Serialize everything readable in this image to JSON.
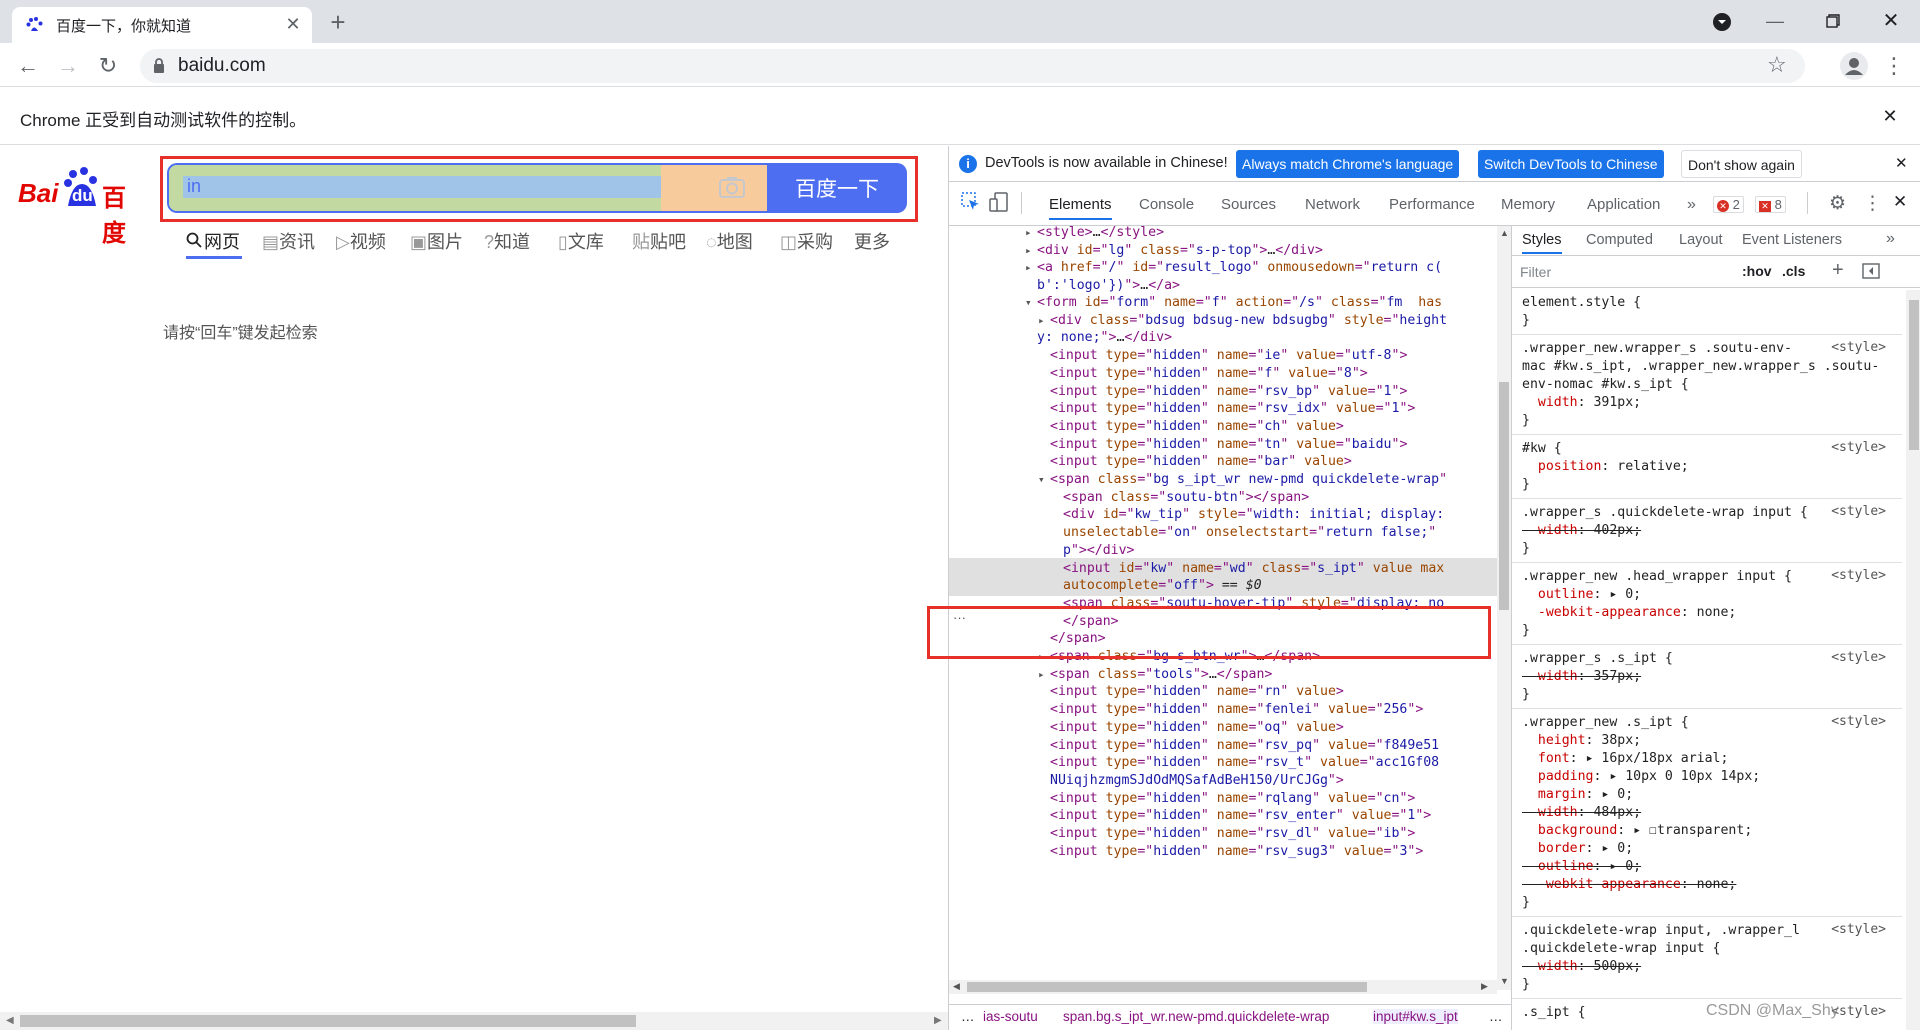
{
  "browser": {
    "tab_title": "百度一下，你就知道",
    "url": "baidu.com",
    "infobar_text": "Chrome 正受到自动测试软件的控制。"
  },
  "page": {
    "logo_text_bai": "Bai",
    "logo_text_du": "du",
    "logo_text_cn": "百度",
    "search_value": "in",
    "search_button": "百度一下",
    "nav": [
      {
        "icon": "search-icon",
        "label": "网页"
      },
      {
        "icon": "news-icon",
        "label": "资讯"
      },
      {
        "icon": "video-icon",
        "label": "视频"
      },
      {
        "icon": "image-icon",
        "label": "图片"
      },
      {
        "icon": "question-icon",
        "label": "知道"
      },
      {
        "icon": "doc-icon",
        "label": "文库"
      },
      {
        "icon": "tieba-icon",
        "label": "贴吧"
      },
      {
        "icon": "map-icon",
        "label": "地图"
      },
      {
        "icon": "bag-icon",
        "label": "采购"
      },
      {
        "icon": "",
        "label": "更多"
      }
    ],
    "hint": "请按“回车”键发起检索"
  },
  "devtools": {
    "notice": "DevTools is now available in Chinese!",
    "btn_match": "Always match Chrome's language",
    "btn_switch": "Switch DevTools to Chinese",
    "btn_dont": "Don't show again",
    "tabs": [
      "Elements",
      "Console",
      "Sources",
      "Network",
      "Performance",
      "Memory",
      "Application"
    ],
    "errors": "2",
    "warnings": "8",
    "elements": [
      {
        "indent": 0,
        "arrow": "▸",
        "html": "<span class='tag'>&lt;style&gt;</span><span class='tx'>…</span><span class='tag'>&lt;/style&gt;</span>"
      },
      {
        "indent": 0,
        "arrow": "▸",
        "html": "<span class='tag'>&lt;div </span><span class='an'>id</span>=\"<span class='av'>lg</span>\" <span class='an'>class</span>=\"<span class='av'>s-p-top</span>\"<span class='tag'>&gt;</span><span class='tx'>…</span><span class='tag'>&lt;/div&gt;</span>"
      },
      {
        "indent": 0,
        "arrow": "▸",
        "html": "<span class='tag'>&lt;a </span><span class='an'>href</span>=\"<span class='av'>/</span>\" <span class='an'>id</span>=\"<span class='av'>result_logo</span>\" <span class='an'>onmousedown</span>=\"<span class='av'>return c(</span>"
      },
      {
        "indent": 0,
        "arrow": "",
        "html": "<span class='av'>b':'logo'})</span>\"<span class='tag'>&gt;</span><span class='tx'>…</span><span class='tag'>&lt;/a&gt;</span>"
      },
      {
        "indent": 0,
        "arrow": "▾",
        "html": "<span class='tag'>&lt;form </span><span class='an'>id</span>=\"<span class='av'>form</span>\" <span class='an'>name</span>=\"<span class='av'>f</span>\" <span class='an'>action</span>=\"<span class='av'>/s</span>\" <span class='an'>class</span>=\"<span class='av'>fm</span>  <span class='an'>has</span>"
      },
      {
        "indent": 1,
        "arrow": "▸",
        "html": "<span class='tag'>&lt;div </span><span class='an'>class</span>=\"<span class='av'>bdsug bdsug-new bdsugbg</span>\" <span class='an'>style</span>=\"<span class='av'>height</span>"
      },
      {
        "indent": 0,
        "arrow": "",
        "html": "<span class='av'>y: none;</span>\"<span class='tag'>&gt;</span><span class='tx'>…</span><span class='tag'>&lt;/div&gt;</span>"
      },
      {
        "indent": 1,
        "arrow": "",
        "html": "<span class='tag'>&lt;input </span><span class='an'>type</span>=\"<span class='av'>hidden</span>\" <span class='an'>name</span>=\"<span class='av'>ie</span>\" <span class='an'>value</span>=\"<span class='av'>utf-8</span>\"<span class='tag'>&gt;</span>"
      },
      {
        "indent": 1,
        "arrow": "",
        "html": "<span class='tag'>&lt;input </span><span class='an'>type</span>=\"<span class='av'>hidden</span>\" <span class='an'>name</span>=\"<span class='av'>f</span>\" <span class='an'>value</span>=\"<span class='av'>8</span>\"<span class='tag'>&gt;</span>"
      },
      {
        "indent": 1,
        "arrow": "",
        "html": "<span class='tag'>&lt;input </span><span class='an'>type</span>=\"<span class='av'>hidden</span>\" <span class='an'>name</span>=\"<span class='av'>rsv_bp</span>\" <span class='an'>value</span>=\"<span class='av'>1</span>\"<span class='tag'>&gt;</span>"
      },
      {
        "indent": 1,
        "arrow": "",
        "html": "<span class='tag'>&lt;input </span><span class='an'>type</span>=\"<span class='av'>hidden</span>\" <span class='an'>name</span>=\"<span class='av'>rsv_idx</span>\" <span class='an'>value</span>=\"<span class='av'>1</span>\"<span class='tag'>&gt;</span>"
      },
      {
        "indent": 1,
        "arrow": "",
        "html": "<span class='tag'>&lt;input </span><span class='an'>type</span>=\"<span class='av'>hidden</span>\" <span class='an'>name</span>=\"<span class='av'>ch</span>\" <span class='an'>value</span><span class='tag'>&gt;</span>"
      },
      {
        "indent": 1,
        "arrow": "",
        "html": "<span class='tag'>&lt;input </span><span class='an'>type</span>=\"<span class='av'>hidden</span>\" <span class='an'>name</span>=\"<span class='av'>tn</span>\" <span class='an'>value</span>=\"<span class='av'>baidu</span>\"<span class='tag'>&gt;</span>"
      },
      {
        "indent": 1,
        "arrow": "",
        "html": "<span class='tag'>&lt;input </span><span class='an'>type</span>=\"<span class='av'>hidden</span>\" <span class='an'>name</span>=\"<span class='av'>bar</span>\" <span class='an'>value</span><span class='tag'>&gt;</span>"
      },
      {
        "indent": 1,
        "arrow": "▾",
        "html": "<span class='tag'>&lt;span </span><span class='an'>class</span>=\"<span class='av'>bg s_ipt_wr new-pmd quickdelete-wrap</span>\""
      },
      {
        "indent": 2,
        "arrow": "",
        "html": "<span class='tag'>&lt;span </span><span class='an'>class</span>=\"<span class='av'>soutu-btn</span>\"<span class='tag'>&gt;&lt;/span&gt;</span>"
      },
      {
        "indent": 2,
        "arrow": "",
        "html": "<span class='tag'>&lt;div </span><span class='an'>id</span>=\"<span class='av'>kw_tip</span>\" <span class='an'>style</span>=\"<span class='av'>width: initial; display:</span>"
      },
      {
        "indent": 2,
        "arrow": "",
        "html": "<span class='an'>unselectable</span>=\"<span class='av'>on</span>\" <span class='an'>onselectstart</span>=\"<span class='av'>return false;</span>\""
      },
      {
        "indent": 2,
        "arrow": "",
        "html": "<span class='av'>p</span>\"<span class='tag'>&gt;&lt;/div&gt;</span>"
      },
      {
        "indent": 2,
        "arrow": "",
        "sel": true,
        "html": "<span class='tag'>&lt;input </span><span class='an'>id</span>=\"<span class='av'>kw</span>\" <span class='an'>name</span>=\"<span class='av'>wd</span>\" <span class='an'>class</span>=\"<span class='av'>s_ipt</span>\" <span class='an'>value</span> <span class='an'>max</span>"
      },
      {
        "indent": 2,
        "arrow": "",
        "sel": true,
        "html": "<span class='an'>autocomplete</span>=\"<span class='av'>off</span>\"<span class='tag'>&gt;</span> <span class='tx'>== <i>$0</i></span>"
      },
      {
        "indent": 2,
        "arrow": "",
        "html": "<span class='tag'>&lt;span </span><span class='an'>class</span>=\"<span class='av'>soutu-hover-tip</span>\" <span class='an'>style</span>=\"<span class='av'>display: no</span>"
      },
      {
        "indent": 2,
        "arrow": "",
        "html": "<span class='tag'>&lt;/span&gt;</span>"
      },
      {
        "indent": 1,
        "arrow": "",
        "html": "<span class='tag'>&lt;/span&gt;</span>"
      },
      {
        "indent": 1,
        "arrow": "▸",
        "html": "<span class='tag'>&lt;span </span><span class='an'>class</span>=\"<span class='av'>bg s_btn_wr</span>\"<span class='tag'>&gt;</span><span class='tx'>…</span><span class='tag'>&lt;/span&gt;</span>"
      },
      {
        "indent": 1,
        "arrow": "▸",
        "html": "<span class='tag'>&lt;span </span><span class='an'>class</span>=\"<span class='av'>tools</span>\"<span class='tag'>&gt;</span><span class='tx'>…</span><span class='tag'>&lt;/span&gt;</span>"
      },
      {
        "indent": 1,
        "arrow": "",
        "html": "<span class='tag'>&lt;input </span><span class='an'>type</span>=\"<span class='av'>hidden</span>\" <span class='an'>name</span>=\"<span class='av'>rn</span>\" <span class='an'>value</span><span class='tag'>&gt;</span>"
      },
      {
        "indent": 1,
        "arrow": "",
        "html": "<span class='tag'>&lt;input </span><span class='an'>type</span>=\"<span class='av'>hidden</span>\" <span class='an'>name</span>=\"<span class='av'>fenlei</span>\" <span class='an'>value</span>=\"<span class='av'>256</span>\"<span class='tag'>&gt;</span>"
      },
      {
        "indent": 1,
        "arrow": "",
        "html": "<span class='tag'>&lt;input </span><span class='an'>type</span>=\"<span class='av'>hidden</span>\" <span class='an'>name</span>=\"<span class='av'>oq</span>\" <span class='an'>value</span><span class='tag'>&gt;</span>"
      },
      {
        "indent": 1,
        "arrow": "",
        "html": "<span class='tag'>&lt;input </span><span class='an'>type</span>=\"<span class='av'>hidden</span>\" <span class='an'>name</span>=\"<span class='av'>rsv_pq</span>\" <span class='an'>value</span>=\"<span class='av'>f849e51</span>"
      },
      {
        "indent": 1,
        "arrow": "",
        "html": "<span class='tag'>&lt;input </span><span class='an'>type</span>=\"<span class='av'>hidden</span>\" <span class='an'>name</span>=\"<span class='av'>rsv_t</span>\" <span class='an'>value</span>=\"<span class='av'>acc1Gf08</span>"
      },
      {
        "indent": 1,
        "arrow": "",
        "html": "<span class='av'>NUiqjhzmgmSJdOdMQSafAdBeH150/UrCJGg</span>\"<span class='tag'>&gt;</span>"
      },
      {
        "indent": 1,
        "arrow": "",
        "html": "<span class='tag'>&lt;input </span><span class='an'>type</span>=\"<span class='av'>hidden</span>\" <span class='an'>name</span>=\"<span class='av'>rqlang</span>\" <span class='an'>value</span>=\"<span class='av'>cn</span>\"<span class='tag'>&gt;</span>"
      },
      {
        "indent": 1,
        "arrow": "",
        "html": "<span class='tag'>&lt;input </span><span class='an'>type</span>=\"<span class='av'>hidden</span>\" <span class='an'>name</span>=\"<span class='av'>rsv_enter</span>\" <span class='an'>value</span>=\"<span class='av'>1</span>\"<span class='tag'>&gt;</span>"
      },
      {
        "indent": 1,
        "arrow": "",
        "html": "<span class='tag'>&lt;input </span><span class='an'>type</span>=\"<span class='av'>hidden</span>\" <span class='an'>name</span>=\"<span class='av'>rsv_dl</span>\" <span class='an'>value</span>=\"<span class='av'>ib</span>\"<span class='tag'>&gt;</span>"
      },
      {
        "indent": 1,
        "arrow": "",
        "html": "<span class='tag'>&lt;input </span><span class='an'>type</span>=\"<span class='av'>hidden</span>\" <span class='an'>name</span>=\"<span class='av'>rsv_sug3</span>\" <span class='an'>value</span>=\"<span class='av'>3</span>\"<span class='tag'>&gt;</span>"
      }
    ],
    "breadcrumb": [
      "…",
      "ias-soutu",
      "span.bg.s_ipt_wr.new-pmd.quickdelete-wrap",
      "input#kw.s_ipt",
      "…"
    ],
    "styles_tabs": [
      "Styles",
      "Computed",
      "Layout",
      "Event Listeners"
    ],
    "filter_placeholder": "Filter",
    "hov": ":hov",
    "cls": ".cls",
    "style_src": "<style>",
    "style_lines": [
      {
        "t": "element.style {",
        "c": "sel"
      },
      {
        "t": "}",
        "c": "sel"
      },
      {
        "t": "sep"
      },
      {
        "t": ".wrapper_new.wrapper_s .soutu-env-",
        "c": "sel",
        "src": true
      },
      {
        "t": "mac #kw.s_ipt, .wrapper_new.wrapper_s .soutu-",
        "c": "sel"
      },
      {
        "t": "env-nomac #kw.s_ipt {",
        "c": "sel"
      },
      {
        "t": "  width: 391px;",
        "c": "prop",
        "p": "width",
        "v": "391px;"
      },
      {
        "t": "}",
        "c": "sel"
      },
      {
        "t": "sep"
      },
      {
        "t": "#kw {",
        "c": "sel",
        "src": true
      },
      {
        "t": "  position: relative;",
        "c": "prop",
        "p": "position",
        "v": "relative;"
      },
      {
        "t": "}",
        "c": "sel"
      },
      {
        "t": "sep"
      },
      {
        "t": ".wrapper_s .quickdelete-wrap input {",
        "c": "sel",
        "src": true
      },
      {
        "t": "  width: 402px;",
        "c": "prop",
        "p": "width",
        "v": "402px;",
        "s": true
      },
      {
        "t": "}",
        "c": "sel"
      },
      {
        "t": "sep"
      },
      {
        "t": ".wrapper_new .head_wrapper input {",
        "c": "sel",
        "src": true
      },
      {
        "t": "  outline: ▸ 0;",
        "c": "prop",
        "p": "outline",
        "v": "▸ 0;"
      },
      {
        "t": "  -webkit-appearance: none;",
        "c": "prop",
        "p": "-webkit-appearance",
        "v": "none;"
      },
      {
        "t": "}",
        "c": "sel"
      },
      {
        "t": "sep"
      },
      {
        "t": ".wrapper_s .s_ipt {",
        "c": "sel",
        "src": true
      },
      {
        "t": "  width: 357px;",
        "c": "prop",
        "p": "width",
        "v": "357px;",
        "s": true
      },
      {
        "t": "}",
        "c": "sel"
      },
      {
        "t": "sep"
      },
      {
        "t": ".wrapper_new .s_ipt {",
        "c": "sel",
        "src": true
      },
      {
        "t": "  height: 38px;",
        "c": "prop",
        "p": "height",
        "v": "38px;"
      },
      {
        "t": "  font: ▸ 16px/18px arial;",
        "c": "prop",
        "p": "font",
        "v": "▸ 16px/18px arial;"
      },
      {
        "t": "  padding: ▸ 10px 0 10px 14px;",
        "c": "prop",
        "p": "padding",
        "v": "▸ 10px 0 10px 14px;"
      },
      {
        "t": "  margin: ▸ 0;",
        "c": "prop",
        "p": "margin",
        "v": "▸ 0;"
      },
      {
        "t": "  width: 484px;",
        "c": "prop",
        "p": "width",
        "v": "484px;",
        "s": true
      },
      {
        "t": "  background: ▸ ☐transparent;",
        "c": "prop",
        "p": "background",
        "v": "▸ ☐transparent;"
      },
      {
        "t": "  border: ▸ 0;",
        "c": "prop",
        "p": "border",
        "v": "▸ 0;"
      },
      {
        "t": "  outline: ▸ 0;",
        "c": "prop",
        "p": "outline",
        "v": "▸ 0;",
        "s": true
      },
      {
        "t": "  -webkit-appearance: none;",
        "c": "prop",
        "p": "-webkit-appearance",
        "v": "none;",
        "s": true
      },
      {
        "t": "}",
        "c": "sel"
      },
      {
        "t": "sep"
      },
      {
        "t": ".quickdelete-wrap input, .wrapper_l",
        "c": "sel",
        "src": true
      },
      {
        "t": ".quickdelete-wrap input {",
        "c": "sel"
      },
      {
        "t": "  width: 500px;",
        "c": "prop",
        "p": "width",
        "v": "500px;",
        "s": true
      },
      {
        "t": "}",
        "c": "sel"
      },
      {
        "t": "sep"
      },
      {
        "t": ".s_ipt {",
        "c": "sel",
        "src": true
      }
    ],
    "watermark": "CSDN @Max_Shy"
  },
  "colors": {
    "baidu_blue": "#4e6ef2",
    "baidu_red": "#e10601",
    "highlight_red": "#e8302a",
    "devtools_btn": "#1a73e8"
  }
}
